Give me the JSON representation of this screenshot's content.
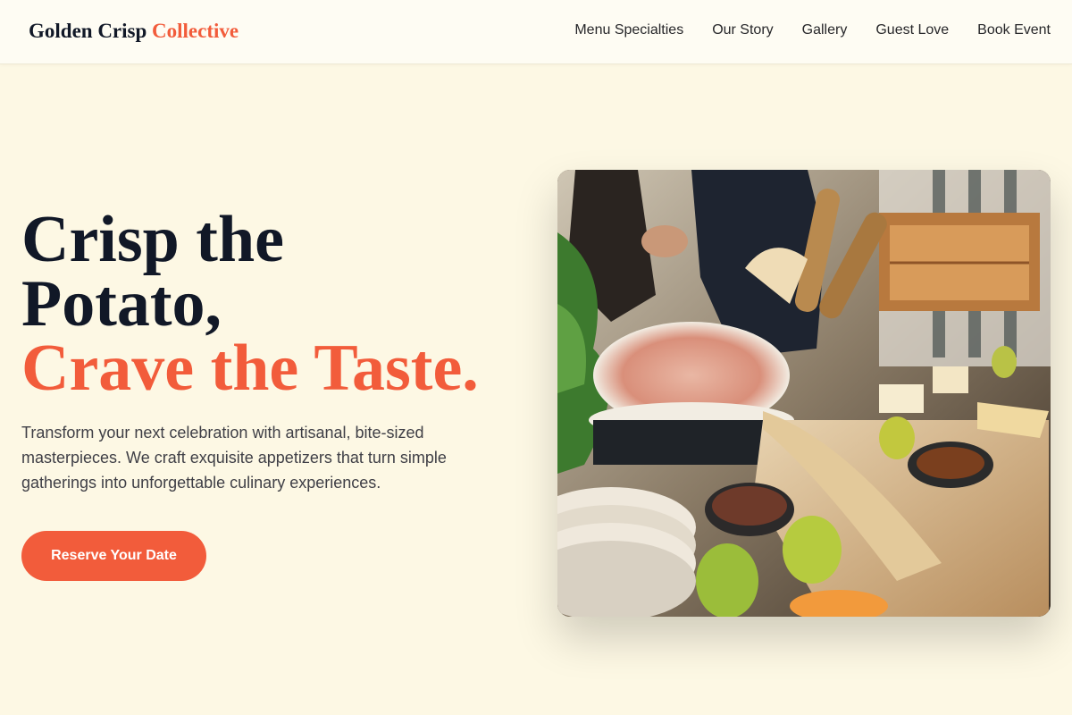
{
  "header": {
    "brand_main": "Golden Crisp",
    "brand_accent": "Collective",
    "nav": [
      {
        "label": "Menu Specialties"
      },
      {
        "label": "Our Story"
      },
      {
        "label": "Gallery"
      },
      {
        "label": "Guest Love"
      },
      {
        "label": "Book Event"
      }
    ]
  },
  "hero": {
    "title_line1": "Crisp the",
    "title_line2": "Potato,",
    "title_line3": "Crave the Taste.",
    "subtitle": "Transform your next celebration with artisanal, bite-sized masterpieces. We craft exquisite appetizers that turn simple gatherings into unforgettable culinary experiences.",
    "cta_label": "Reserve Your Date",
    "image_alt": "Catering table"
  },
  "colors": {
    "background": "#fdf8e4",
    "header_bg": "#fefcf3",
    "accent": "#f25c3b",
    "heading": "#111827",
    "body_text": "#3f3f46"
  }
}
